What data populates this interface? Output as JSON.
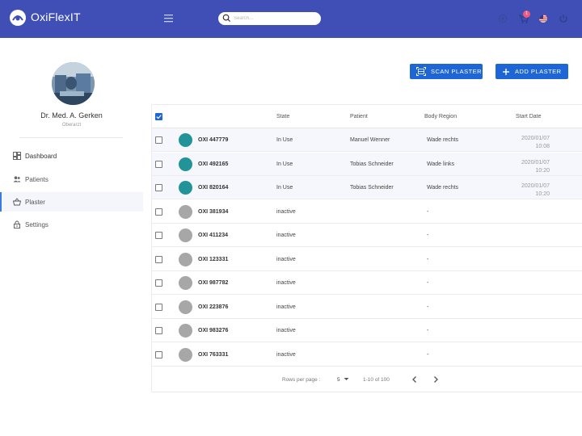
{
  "header": {
    "brand": "OxiFlexIT",
    "search_placeholder": "Search...",
    "notification_count": "1"
  },
  "profile": {
    "name": "Dr. Med. A. Gerken",
    "role": "Oberarzt"
  },
  "sidebar": {
    "items": [
      {
        "label": "Dashboard",
        "icon": "dashboard-icon"
      },
      {
        "label": "Patients",
        "icon": "patients-icon"
      },
      {
        "label": "Plaster",
        "icon": "basket-icon",
        "active": true
      },
      {
        "label": "Settings",
        "icon": "lock-icon"
      }
    ]
  },
  "actions": {
    "scan_label": "SCAN PLASTER",
    "add_label": "ADD PLASTER"
  },
  "table": {
    "columns": [
      "State",
      "Patient",
      "Body Region",
      "Start Date"
    ],
    "rows": [
      {
        "id": "OXI 447779",
        "state": "In Use",
        "patient": "Manuel Wenner",
        "region": "Wade rechts",
        "date": "2020/01/07",
        "time": "10:08",
        "status_color": "#23939a"
      },
      {
        "id": "OXI 492165",
        "state": "In Use",
        "patient": "Tobias Schneider",
        "region": "Wade links",
        "date": "2020/01/07",
        "time": "10:20",
        "status_color": "#23939a"
      },
      {
        "id": "OXI 820164",
        "state": "In Use",
        "patient": "Tobias Schneider",
        "region": "Wade rechts",
        "date": "2020/01/07",
        "time": "10:20",
        "status_color": "#23939a"
      },
      {
        "id": "OXI 381934",
        "state": "inactive",
        "patient": "",
        "region": "-",
        "date": "",
        "time": "",
        "status_color": "#a7a7a7"
      },
      {
        "id": "OXI 411234",
        "state": "inactive",
        "patient": "",
        "region": "-",
        "date": "",
        "time": "",
        "status_color": "#a7a7a7"
      },
      {
        "id": "OXI 123331",
        "state": "inactive",
        "patient": "",
        "region": "-",
        "date": "",
        "time": "",
        "status_color": "#a7a7a7"
      },
      {
        "id": "OXI 987782",
        "state": "inactive",
        "patient": "",
        "region": "-",
        "date": "",
        "time": "",
        "status_color": "#a7a7a7"
      },
      {
        "id": "OXI 223876",
        "state": "inactive",
        "patient": "",
        "region": "-",
        "date": "",
        "time": "",
        "status_color": "#a7a7a7"
      },
      {
        "id": "OXI 983276",
        "state": "inactive",
        "patient": "",
        "region": "-",
        "date": "",
        "time": "",
        "status_color": "#a7a7a7"
      },
      {
        "id": "OXI 763331",
        "state": "inactive",
        "patient": "",
        "region": "-",
        "date": "",
        "time": "",
        "status_color": "#a7a7a7"
      }
    ]
  },
  "pagination": {
    "rows_per_page_label": "Rows per page :",
    "rows_per_page_value": "5",
    "range_text": "1-10 of 100"
  },
  "colors": {
    "header_bg": "#3f4fb5",
    "primary": "#1e66d6",
    "in_use": "#23939a",
    "inactive": "#a7a7a7"
  }
}
